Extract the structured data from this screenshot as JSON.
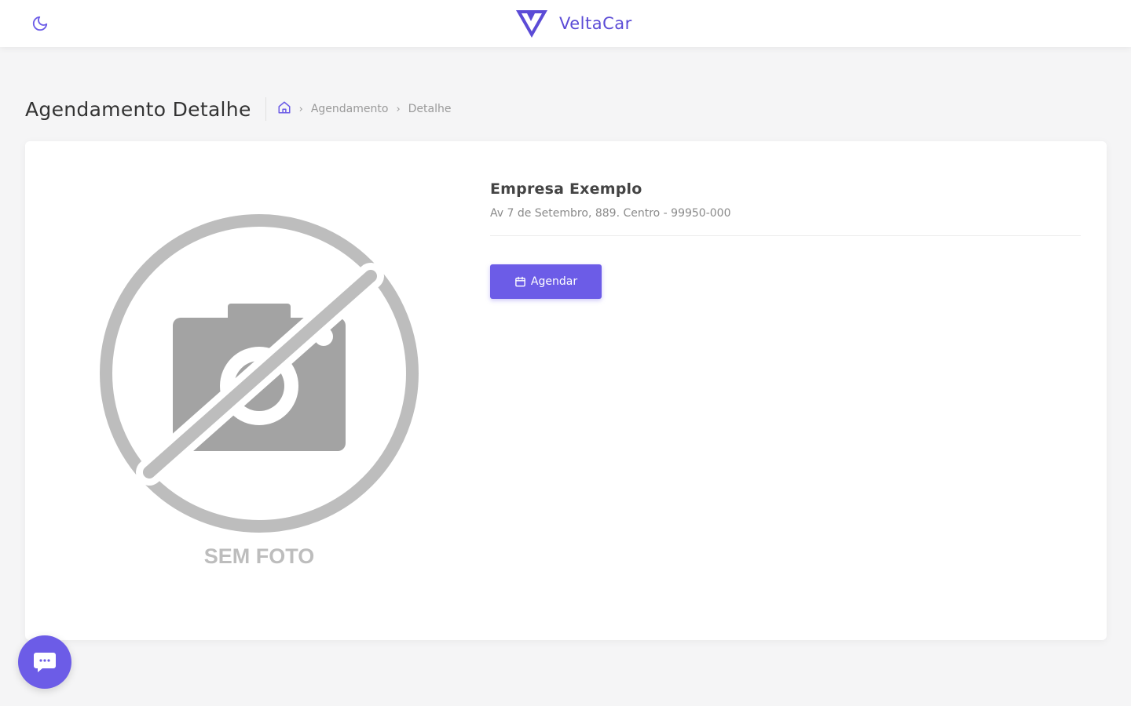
{
  "header": {
    "theme_toggle_icon": "moon-icon",
    "brand_logo_icon": "veltacar-logo-icon",
    "brand_name": "VeltaCar"
  },
  "page": {
    "title": "Agendamento Detalhe",
    "breadcrumb": {
      "home_icon": "home-icon",
      "items": [
        "Agendamento",
        "Detalhe"
      ]
    }
  },
  "company": {
    "name": "Empresa Exemplo",
    "address": "Av 7 de Setembro, 889. Centro - 99950-000",
    "photo_placeholder": "SEM FOTO"
  },
  "actions": {
    "schedule_label": "Agendar",
    "schedule_icon": "calendar-icon"
  },
  "chat": {
    "icon": "chat-bubble-icon"
  },
  "colors": {
    "accent": "#6c5ce7",
    "brand": "#5b4bd6",
    "background": "#f5f5f6",
    "placeholder_gray": "#bdbdbd"
  }
}
